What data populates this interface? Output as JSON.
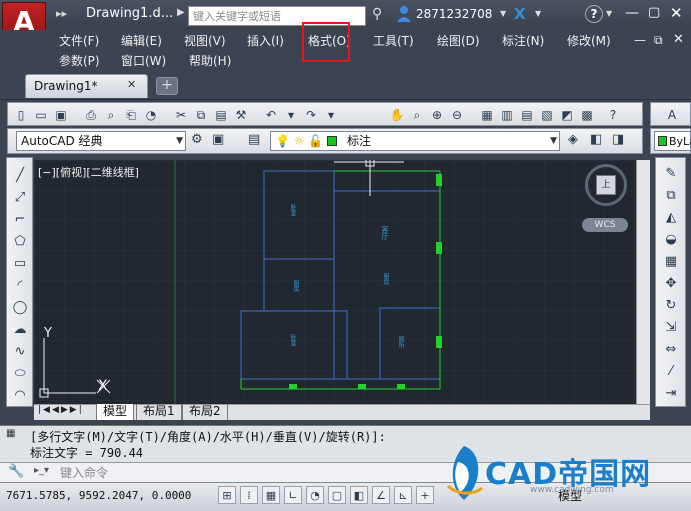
{
  "titlebar": {
    "doc_title": "Drawing1.d...",
    "search_placeholder": "键入关键字或短语",
    "user_name": "2871232708",
    "nav_arrows": "▸▸"
  },
  "menu": {
    "row1": [
      "文件(F)",
      "编辑(E)",
      "视图(V)",
      "插入(I)",
      "格式(O)",
      "工具(T)",
      "绘图(D)",
      "标注(N)",
      "修改(M)"
    ],
    "row2": [
      "参数(P)",
      "窗口(W)",
      "帮助(H)"
    ],
    "highlighted": "格式(O)"
  },
  "tabs": {
    "active": "Drawing1*"
  },
  "toolbar": {
    "workspace": "AutoCAD 经典",
    "layer": "标注",
    "bylayer": "ByLa"
  },
  "canvas": {
    "view_label": "[−][俯视][二维线框]",
    "viewcube_face": "上",
    "wcs_label": "WCS",
    "ucs_x": "X",
    "ucs_y": "Y",
    "room_labels": [
      "卧室",
      "客厅",
      "厨房",
      "厨房",
      "卧室",
      "厕所"
    ]
  },
  "layout_tabs": [
    "模型",
    "布局1",
    "布局2"
  ],
  "command": {
    "history_1": "[多行文字(M)/文字(T)/角度(A)/水平(H)/垂直(V)/旋转(R)]:",
    "history_2": "标注文字 = 790.44",
    "input_placeholder": "键入命令"
  },
  "status": {
    "coords": "7671.5785,  9592.2047, 0.0000",
    "model_label": "模型"
  },
  "watermark": {
    "brand": "CAD帝国网",
    "url": "www.cadwing.com"
  },
  "colors": {
    "accent_red": "#e8141c",
    "canvas_bg": "#212830",
    "wall_blue": "#3a6fd0",
    "wall_green": "#23d12b"
  }
}
